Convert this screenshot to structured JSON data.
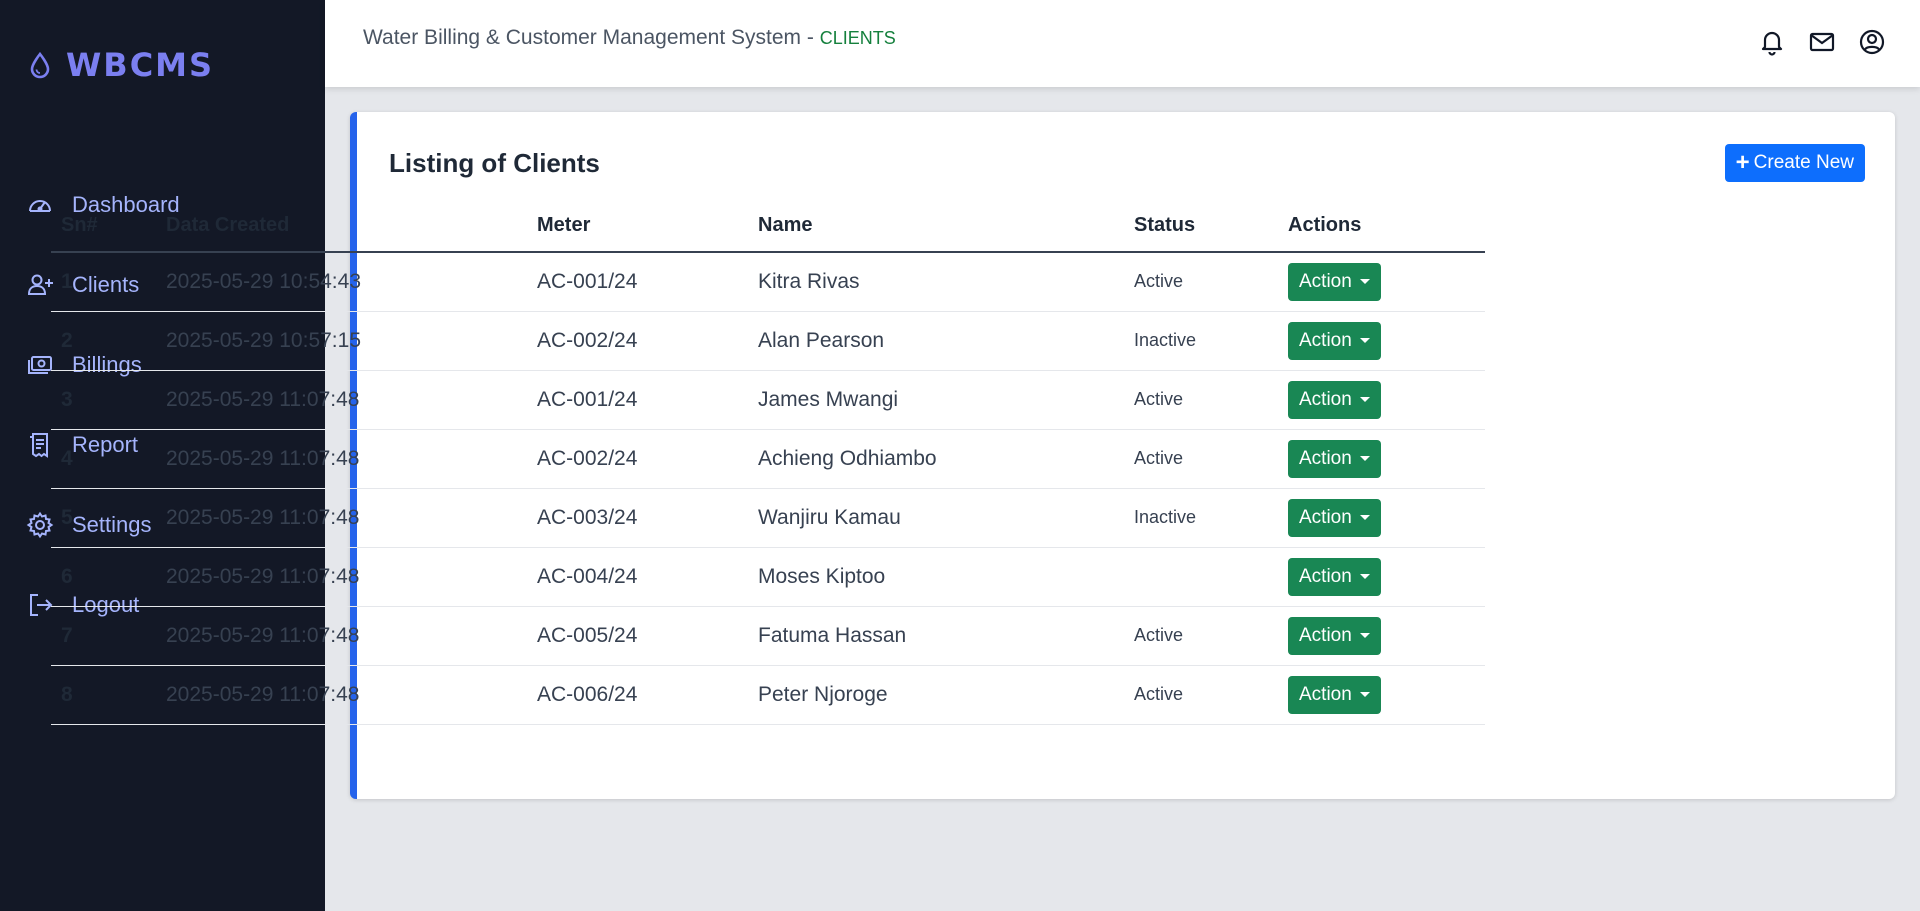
{
  "brand": {
    "name": "WBCMS",
    "icon": "water-drop-icon",
    "color": "#7b7ff0"
  },
  "sidebar": {
    "items": [
      {
        "label": "Dashboard",
        "icon": "speedometer-icon"
      },
      {
        "label": "Clients",
        "icon": "add-user-icon"
      },
      {
        "label": "Billings",
        "icon": "money-icon"
      },
      {
        "label": "Report",
        "icon": "receipt-icon"
      },
      {
        "label": "Settings",
        "icon": "gear-icon"
      },
      {
        "label": "Logout",
        "icon": "logout-icon"
      }
    ]
  },
  "header": {
    "title": "Water Billing & Customer Management System",
    "separator": "-",
    "breadcrumb": "CLIENTS",
    "icons": [
      "bell-icon",
      "mail-icon",
      "user-circle-icon"
    ]
  },
  "card": {
    "title": "Listing of Clients",
    "create_button": "Create New",
    "accent_color": "#2563eb"
  },
  "table": {
    "columns": [
      "Sn#",
      "Data Created",
      "Meter",
      "Name",
      "Status",
      "Actions"
    ],
    "action_label": "Action",
    "rows": [
      {
        "sn": "1",
        "created": "2025-05-29 10:54:43",
        "meter": "AC-001/24",
        "name": "Kitra Rivas",
        "status": "Active"
      },
      {
        "sn": "2",
        "created": "2025-05-29 10:57:15",
        "meter": "AC-002/24",
        "name": "Alan Pearson",
        "status": "Inactive"
      },
      {
        "sn": "3",
        "created": "2025-05-29 11:07:48",
        "meter": "AC-001/24",
        "name": "James Mwangi",
        "status": "Active"
      },
      {
        "sn": "4",
        "created": "2025-05-29 11:07:48",
        "meter": "AC-002/24",
        "name": "Achieng Odhiambo",
        "status": "Active"
      },
      {
        "sn": "5",
        "created": "2025-05-29 11:07:48",
        "meter": "AC-003/24",
        "name": "Wanjiru Kamau",
        "status": "Inactive"
      },
      {
        "sn": "6",
        "created": "2025-05-29 11:07:48",
        "meter": "AC-004/24",
        "name": "Moses Kiptoo",
        "status": ""
      },
      {
        "sn": "7",
        "created": "2025-05-29 11:07:48",
        "meter": "AC-005/24",
        "name": "Fatuma Hassan",
        "status": "Active"
      },
      {
        "sn": "8",
        "created": "2025-05-29 11:07:48",
        "meter": "AC-006/24",
        "name": "Peter Njoroge",
        "status": "Active"
      }
    ]
  },
  "colors": {
    "sidebar_bg": "#131826",
    "nav_text": "#a5b4fc",
    "primary": "#0d6efd",
    "success": "#198754",
    "breadcrumb": "#15803d"
  }
}
